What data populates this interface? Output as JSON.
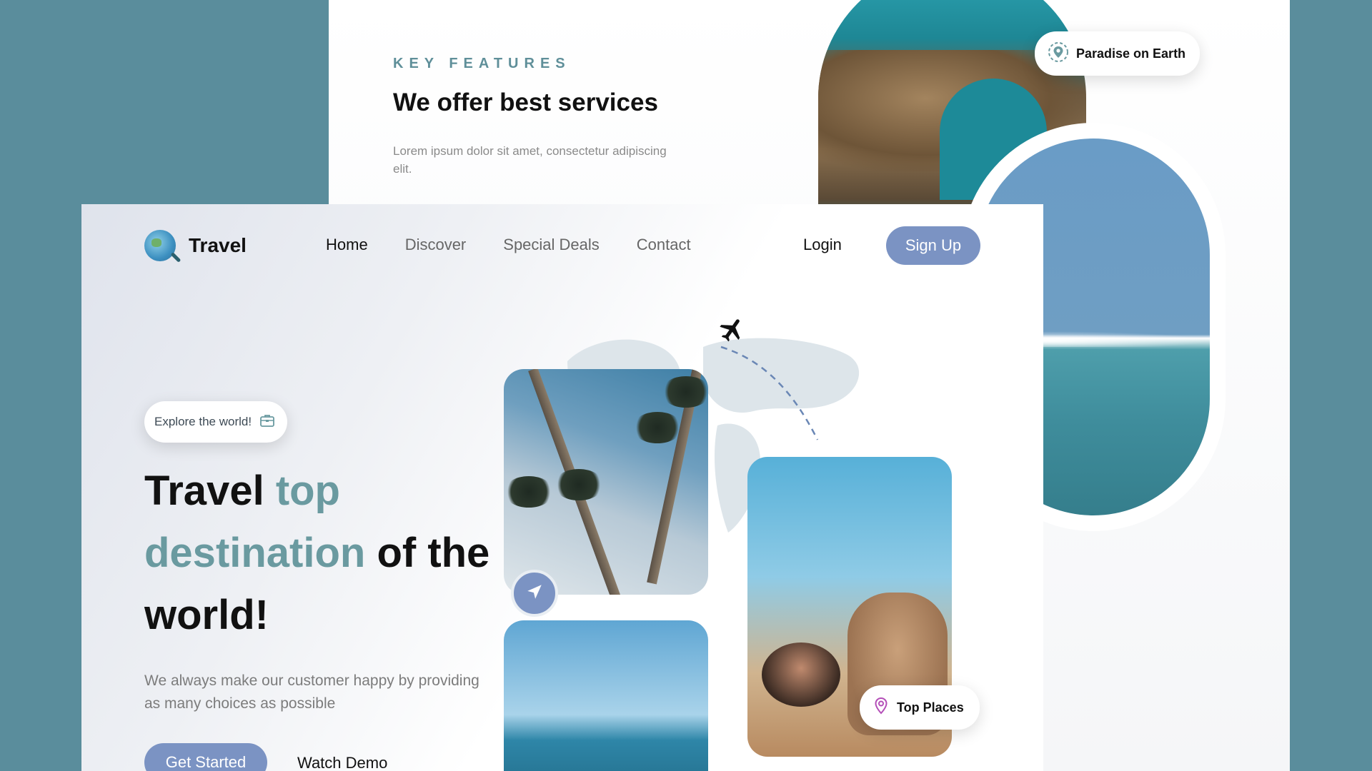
{
  "back_card": {
    "eyebrow": "KEY FEATURES",
    "title": "We offer best services",
    "text": "Lorem ipsum dolor sit amet, consectetur adipiscing elit.",
    "location_pill": "Paradise on Earth"
  },
  "nav": {
    "brand": "Travel",
    "links": [
      "Home",
      "Discover",
      "Special Deals",
      "Contact"
    ],
    "login": "Login",
    "signup": "Sign Up"
  },
  "hero": {
    "explore_pill": "Explore the world!",
    "title_part1": "Travel ",
    "title_accent": "top destination",
    "title_part2": " of the world!",
    "subtitle": "We always make our customer happy by providing as many choices as possible",
    "get_started": "Get Started",
    "watch_demo": "Watch Demo",
    "top_places_pill": "Top Places"
  },
  "colors": {
    "background": "#5a8d9c",
    "accent_teal": "#6a9aa0",
    "button_blue": "#7b93c3"
  },
  "icons": [
    "globe-search-icon",
    "briefcase-icon",
    "location-pin-icon",
    "navigation-arrow-icon",
    "airplane-icon",
    "map-pin-icon"
  ]
}
